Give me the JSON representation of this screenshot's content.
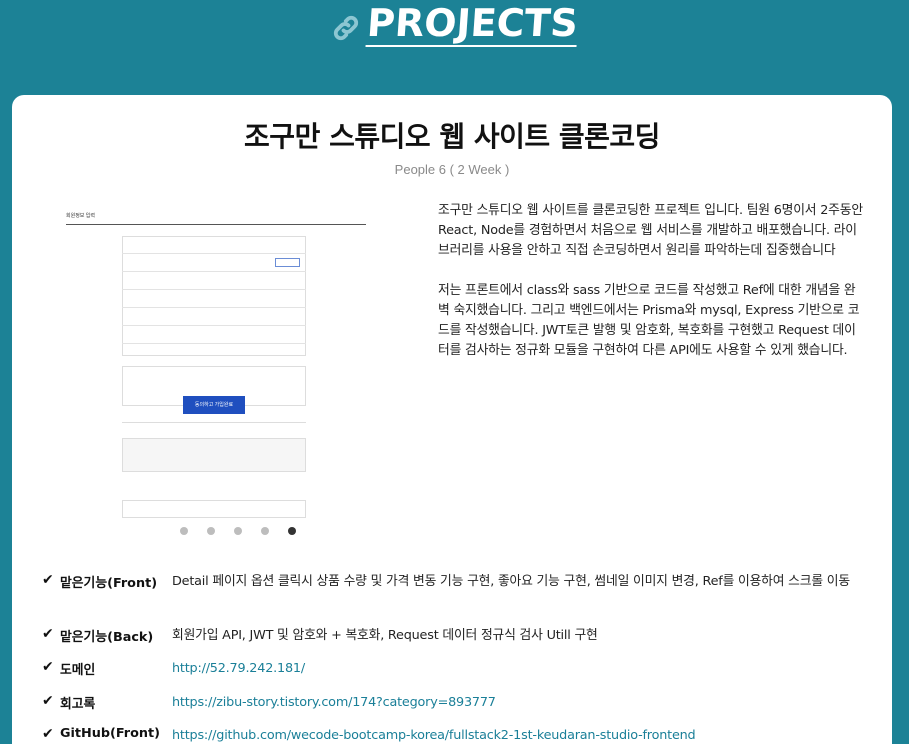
{
  "header": {
    "icon": "link-icon",
    "title": "PROJECTS"
  },
  "project": {
    "title": "조구만 스튜디오 웹 사이트 클론코딩",
    "subtitle": "People 6 ( 2 Week )",
    "description": [
      "조구만 스튜디오 웹 사이트를 클론코딩한 프로젝트 입니다. 팀원 6명이서 2주동안 React, Node를 경험하면서 처음으로 웹 서비스를 개발하고 배포했습니다. 라이브러리를 사용을 안하고 직접 손코딩하면서 원리를 파악하는데 집중했습니다",
      "저는 프론트에서 class와 sass 기반으로 코드를 작성했고 Ref에 대한 개념을 완벽 숙지했습니다. 그리고 백엔드에서는 Prisma와 mysql, Express 기반으로 코드를 작성했습니다. JWT토큰 발행 및 암호화, 복호화를 구현했고 Request 데이터를 검사하는 정규화 모듈을 구현하여 다른 API에도 사용할 수 있게 했습니다."
    ],
    "carousel": {
      "slide_count": 5,
      "active_index": 4,
      "screenshot": {
        "heading": "회원정보 입력",
        "button": "동의하고 가입완료"
      }
    },
    "details": [
      {
        "check": "✔",
        "label": "맡은기능(Front)",
        "value": "Detail 페이지 옵션 클릭시 상품 수량 및 가격 변동 기능 구현, 좋아요 기능 구현, 썸네일 이미지 변경, Ref를 이용하여 스크롤 이동",
        "is_link": false
      },
      {
        "check": "✔",
        "label": "맡은기능(Back)",
        "value": "회원가입 API, JWT 및 암호와 + 복호화, Request 데이터 정규식 검사 Utill 구현",
        "is_link": false
      },
      {
        "check": "✔",
        "label": "도메인",
        "value": "http://52.79.242.181/",
        "is_link": true
      },
      {
        "check": "✔",
        "label": "회고록",
        "value": "https://zibu-story.tistory.com/174?category=893777",
        "is_link": true
      },
      {
        "check": "✔",
        "label": "GitHub(Front)",
        "value": "https://github.com/wecode-bootcamp-korea/fullstack2-1st-keudaran-studio-frontend",
        "is_link": true
      }
    ]
  },
  "colors": {
    "background": "#1c8296",
    "card": "#ffffff",
    "link": "#1a7f98",
    "muted": "#8a8a8a"
  }
}
